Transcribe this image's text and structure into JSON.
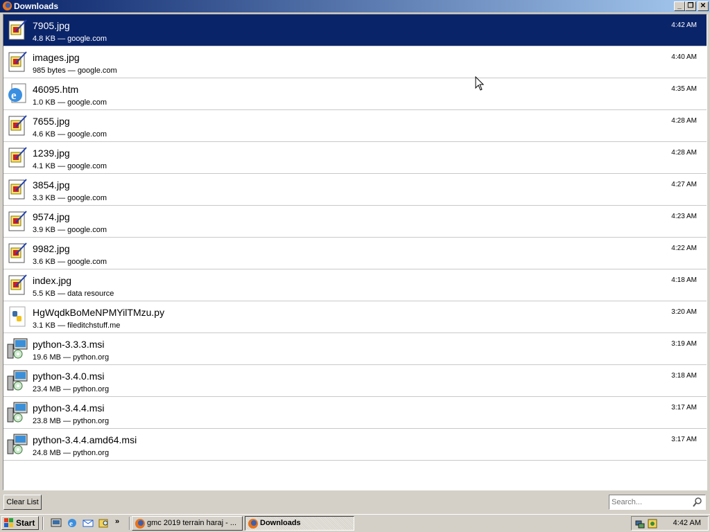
{
  "window": {
    "title": "Downloads"
  },
  "downloads": [
    {
      "name": "7905.jpg",
      "meta": "4.8 KB — google.com",
      "time": "4:42 AM",
      "icon": "jpg-file-icon",
      "selected": true
    },
    {
      "name": "images.jpg",
      "meta": "985 bytes — google.com",
      "time": "4:40 AM",
      "icon": "jpg-file-icon"
    },
    {
      "name": "46095.htm",
      "meta": "1.0 KB — google.com",
      "time": "4:35 AM",
      "icon": "ie-html-file-icon"
    },
    {
      "name": "7655.jpg",
      "meta": "4.6 KB — google.com",
      "time": "4:28 AM",
      "icon": "jpg-file-icon"
    },
    {
      "name": "1239.jpg",
      "meta": "4.1 KB — google.com",
      "time": "4:28 AM",
      "icon": "jpg-file-icon"
    },
    {
      "name": "3854.jpg",
      "meta": "3.3 KB — google.com",
      "time": "4:27 AM",
      "icon": "jpg-file-icon"
    },
    {
      "name": "9574.jpg",
      "meta": "3.9 KB — google.com",
      "time": "4:23 AM",
      "icon": "jpg-file-icon"
    },
    {
      "name": "9982.jpg",
      "meta": "3.6 KB — google.com",
      "time": "4:22 AM",
      "icon": "jpg-file-icon"
    },
    {
      "name": "index.jpg",
      "meta": "5.5 KB — data resource",
      "time": "4:18 AM",
      "icon": "jpg-file-icon"
    },
    {
      "name": "HgWqdkBoMeNPMYilTMzu.py",
      "meta": "3.1 KB — fileditchstuff.me",
      "time": "3:20 AM",
      "icon": "python-file-icon"
    },
    {
      "name": "python-3.3.3.msi",
      "meta": "19.6 MB — python.org",
      "time": "3:19 AM",
      "icon": "msi-installer-icon"
    },
    {
      "name": "python-3.4.0.msi",
      "meta": "23.4 MB — python.org",
      "time": "3:18 AM",
      "icon": "msi-installer-icon"
    },
    {
      "name": "python-3.4.4.msi",
      "meta": "23.8 MB — python.org",
      "time": "3:17 AM",
      "icon": "msi-installer-icon"
    },
    {
      "name": "python-3.4.4.amd64.msi",
      "meta": "24.8 MB — python.org",
      "time": "3:17 AM",
      "icon": "msi-installer-icon"
    }
  ],
  "bottom": {
    "clear_label": "Clear List",
    "search_placeholder": "Search..."
  },
  "taskbar": {
    "start_label": "Start",
    "tasks": [
      {
        "label": "gmc 2019 terrain haraj - ...",
        "active": false
      },
      {
        "label": "Downloads",
        "active": true
      }
    ],
    "clock": "4:42 AM"
  },
  "colors": {
    "selection": "#0a246a",
    "titlebar": "#0a246a",
    "face": "#d4d0c8"
  }
}
